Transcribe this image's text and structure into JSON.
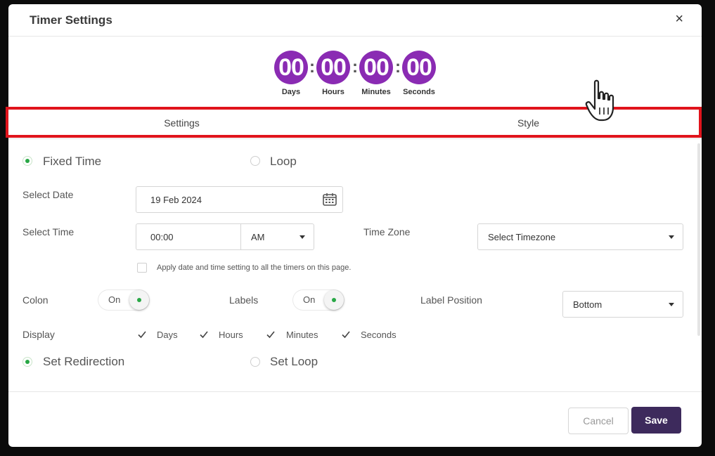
{
  "modal": {
    "title": "Timer Settings",
    "close": "×"
  },
  "timer": {
    "units": [
      {
        "value": "00",
        "label": "Days"
      },
      {
        "value": "00",
        "label": "Hours"
      },
      {
        "value": "00",
        "label": "Minutes"
      },
      {
        "value": "00",
        "label": "Seconds"
      }
    ],
    "separator": ":",
    "accent_color": "#8a2bb3"
  },
  "tabs": [
    {
      "label": "Settings"
    },
    {
      "label": "Style"
    }
  ],
  "highlight_color": "#e0141c",
  "mode": {
    "fixed_time_label": "Fixed Time",
    "loop_label": "Loop",
    "selected": "Fixed Time"
  },
  "date": {
    "label": "Select Date",
    "value": "19 Feb 2024"
  },
  "time": {
    "label": "Select Time",
    "value": "00:00",
    "ampm": "AM",
    "timezone_label": "Time Zone",
    "timezone_value": "Select Timezone"
  },
  "apply_all": {
    "label": "Apply date and time setting to all the timers on this page.",
    "checked": false
  },
  "colon": {
    "label": "Colon",
    "state": "On"
  },
  "labels": {
    "label": "Labels",
    "state": "On"
  },
  "label_position": {
    "label": "Label Position",
    "value": "Bottom"
  },
  "display": {
    "label": "Display",
    "options": [
      {
        "label": "Days",
        "checked": true
      },
      {
        "label": "Hours",
        "checked": true
      },
      {
        "label": "Minutes",
        "checked": true
      },
      {
        "label": "Seconds",
        "checked": true
      }
    ]
  },
  "redirection": {
    "set_redirection_label": "Set Redirection",
    "set_loop_label": "Set Loop",
    "selected": "Set Redirection"
  },
  "footer": {
    "cancel_label": "Cancel",
    "save_label": "Save"
  },
  "colors": {
    "save_bg": "#3d2a5c",
    "radio_active": "#28a745"
  }
}
